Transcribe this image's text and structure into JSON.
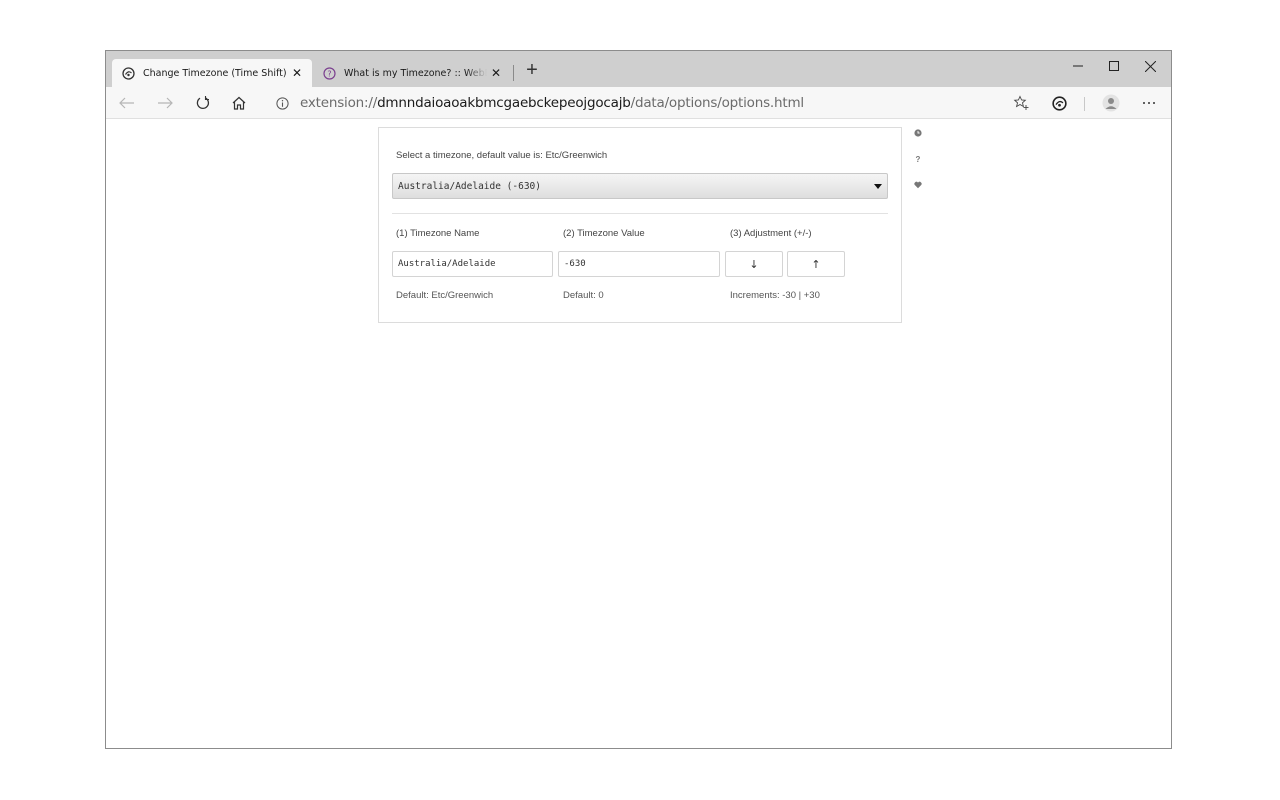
{
  "browser": {
    "tabs": [
      {
        "title": "Change Timezone (Time Shift)",
        "active": true,
        "icon": "timeshift-icon"
      },
      {
        "title": "What is my Timezone? :: WebBrowserTools",
        "active": false,
        "icon": "question-circle-icon"
      }
    ],
    "new_tab_label": "+",
    "address": {
      "scheme": "extension://",
      "host": "dmnndaioaoakbmcgaebckepeojgocajb",
      "path": "/data/options/options.html"
    },
    "window_controls": {
      "minimize": "–",
      "maximize": "☐",
      "close": "✕"
    }
  },
  "options": {
    "select_label": "Select a timezone, default value is: Etc/Greenwich",
    "selected_timezone": "Australia/Adelaide (-630)",
    "columns": {
      "name": "(1) Timezone Name",
      "value": "(2) Timezone Value",
      "adjust": "(3) Adjustment (+/-)"
    },
    "fields": {
      "name_value": "Australia/Adelaide",
      "value_value": "-630"
    },
    "buttons": {
      "down": "↓",
      "up": "↑"
    },
    "notes": {
      "name_default": "Default: Etc/Greenwich",
      "value_default": "Default: 0",
      "increments": "Increments: -30 | +30"
    },
    "side_icons": {
      "help": "?"
    }
  },
  "colors": {
    "tabstrip": "#cfcfcf",
    "toolbar": "#f7f7f7",
    "inactive_tab_icon": "#7b3f8f"
  }
}
